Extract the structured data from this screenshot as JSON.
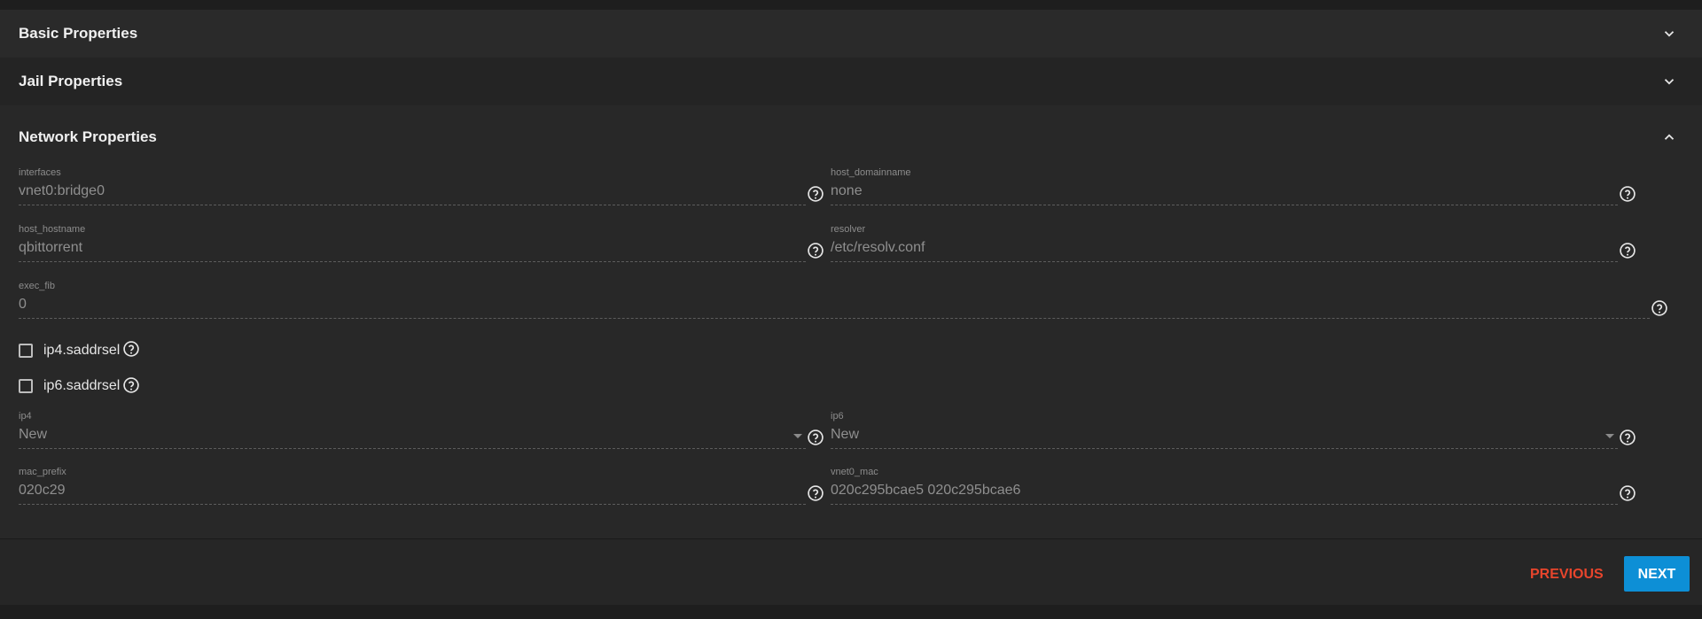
{
  "sections": {
    "basic": {
      "title": "Basic Properties",
      "expanded": false,
      "icon": "chevron-down-icon"
    },
    "jail": {
      "title": "Jail Properties",
      "expanded": false,
      "icon": "chevron-down-icon"
    },
    "network": {
      "title": "Network Properties",
      "expanded": true,
      "icon": "chevron-up-icon"
    }
  },
  "network": {
    "interfaces": {
      "label": "interfaces",
      "value": "vnet0:bridge0"
    },
    "host_domainname": {
      "label": "host_domainname",
      "value": "none"
    },
    "host_hostname": {
      "label": "host_hostname",
      "value": "qbittorrent"
    },
    "resolver": {
      "label": "resolver",
      "value": "/etc/resolv.conf"
    },
    "exec_fib": {
      "label": "exec_fib",
      "value": "0"
    },
    "ip4_saddrsel": {
      "label": "ip4.saddrsel",
      "checked": false
    },
    "ip6_saddrsel": {
      "label": "ip6.saddrsel",
      "checked": false
    },
    "ip4": {
      "label": "ip4",
      "value": "New"
    },
    "ip6": {
      "label": "ip6",
      "value": "New"
    },
    "mac_prefix": {
      "label": "mac_prefix",
      "value": "020c29"
    },
    "vnet0_mac": {
      "label": "vnet0_mac",
      "value": "020c295bcae5 020c295bcae6"
    }
  },
  "footer": {
    "previous_label": "PREVIOUS",
    "next_label": "NEXT"
  },
  "colors": {
    "background": "#1e1e1e",
    "panel": "#282828",
    "accent_next": "#0d8fd6",
    "accent_previous": "#e8452c"
  }
}
